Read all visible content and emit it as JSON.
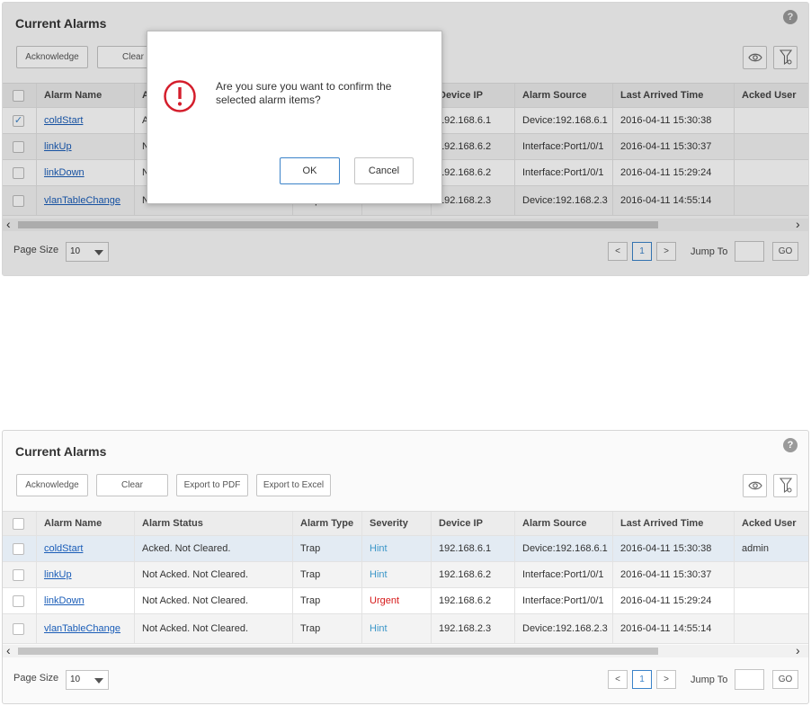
{
  "panel_title": "Current Alarms",
  "help_label": "?",
  "toolbar": {
    "acknowledge": "Acknowledge",
    "clear": "Clear",
    "export_pdf": "Export to PDF",
    "export_excel": "Export to Excel"
  },
  "columns": [
    "Alarm Name",
    "Alarm Status",
    "Alarm Type",
    "Severity",
    "Device IP",
    "Alarm Source",
    "Last Arrived Time",
    "Acked User"
  ],
  "top_rows": [
    {
      "checked": true,
      "checkmark": "✓",
      "name": "coldStart",
      "status": "Acked. Not Cleared.",
      "type": "Trap",
      "severity": "Hint",
      "ip": "192.168.6.1",
      "source": "Device:192.168.6.1",
      "time": "2016-04-11 15:30:38",
      "user": ""
    },
    {
      "checked": false,
      "checkmark": "",
      "name": "linkUp",
      "status": "Not Acked. Not Cleared.",
      "type": "Trap",
      "severity": "Hint",
      "ip": "192.168.6.2",
      "source": "Interface:Port1/0/1",
      "time": "2016-04-11 15:30:37",
      "user": ""
    },
    {
      "checked": false,
      "checkmark": "",
      "name": "linkDown",
      "status": "Not Acked. Not Cleared.",
      "type": "Trap",
      "severity": "Urgent",
      "ip": "192.168.6.2",
      "source": "Interface:Port1/0/1",
      "time": "2016-04-11 15:29:24",
      "user": ""
    },
    {
      "checked": false,
      "checkmark": "",
      "name": "vlanTableChange",
      "status": "Not Acked. Not Cleared.",
      "type": "Trap",
      "severity": "Hint",
      "ip": "192.168.2.3",
      "source": "Device:192.168.2.3",
      "time": "2016-04-11 14:55:14",
      "user": ""
    }
  ],
  "bottom_rows": [
    {
      "checked": false,
      "checkmark": "",
      "name": "coldStart",
      "status": "Acked. Not Cleared.",
      "type": "Trap",
      "severity": "Hint",
      "ip": "192.168.6.1",
      "source": "Device:192.168.6.1",
      "time": "2016-04-11 15:30:38",
      "user": "admin"
    },
    {
      "checked": false,
      "checkmark": "",
      "name": "linkUp",
      "status": "Not Acked. Not Cleared.",
      "type": "Trap",
      "severity": "Hint",
      "ip": "192.168.6.2",
      "source": "Interface:Port1/0/1",
      "time": "2016-04-11 15:30:37",
      "user": ""
    },
    {
      "checked": false,
      "checkmark": "",
      "name": "linkDown",
      "status": "Not Acked. Not Cleared.",
      "type": "Trap",
      "severity": "Urgent",
      "ip": "192.168.6.2",
      "source": "Interface:Port1/0/1",
      "time": "2016-04-11 15:29:24",
      "user": ""
    },
    {
      "checked": false,
      "checkmark": "",
      "name": "vlanTableChange",
      "status": "Not Acked. Not Cleared.",
      "type": "Trap",
      "severity": "Hint",
      "ip": "192.168.2.3",
      "source": "Device:192.168.2.3",
      "time": "2016-04-11 14:55:14",
      "user": ""
    }
  ],
  "pager": {
    "page_size_label": "Page Size",
    "page_size_value": "10",
    "prev": "<",
    "current_page": "1",
    "next": ">",
    "jump_label": "Jump To",
    "go_label": "GO"
  },
  "dialog": {
    "message": "Are you sure you want to confirm the selected alarm items?",
    "ok": "OK",
    "cancel": "Cancel"
  },
  "colors": {
    "hint": "#3b96c8",
    "urgent": "#d61a1a",
    "link": "#1a5db8",
    "warn": "#d41e2c"
  },
  "icons": [
    "help-icon",
    "eye-icon",
    "filter-settings-icon",
    "warning-icon",
    "check-icon"
  ]
}
